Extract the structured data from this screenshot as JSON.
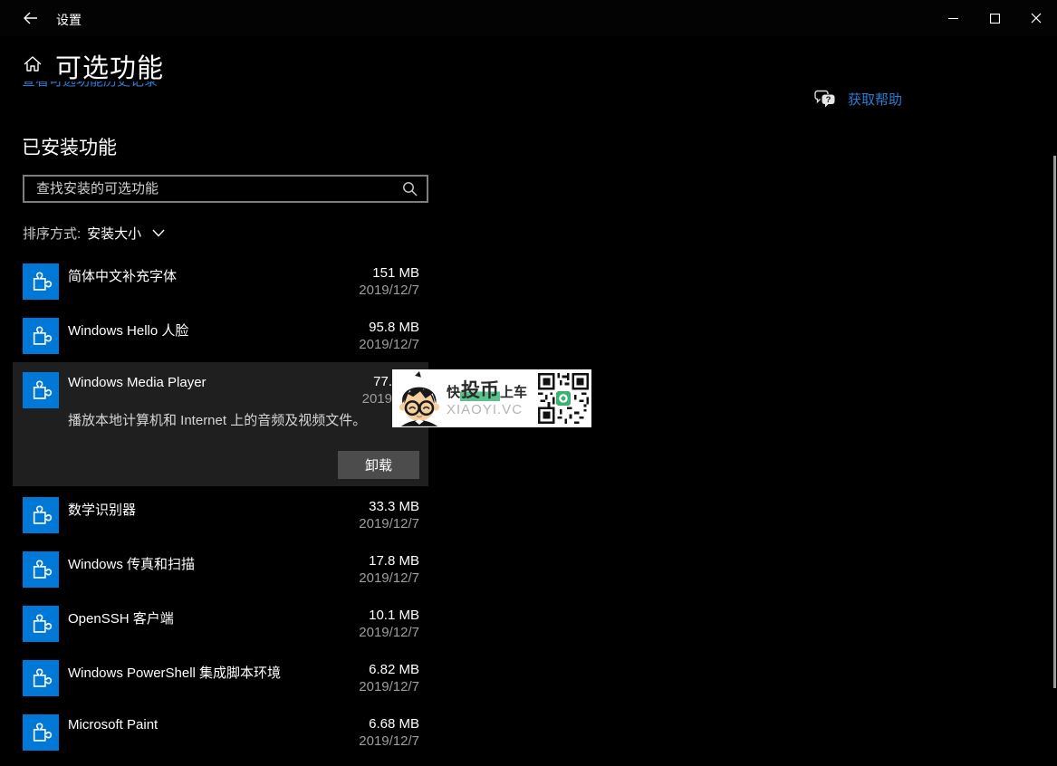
{
  "titlebar": {
    "app_title": "设置"
  },
  "header": {
    "title": "可选功能",
    "history_link": "查看可选功能历史记录",
    "get_help": "获取帮助"
  },
  "main": {
    "section_title": "已安装功能",
    "search_placeholder": "查找安装的可选功能",
    "sort_label": "排序方式:",
    "sort_value": "安装大小",
    "features": [
      {
        "name": "简体中文补充字体",
        "size": "151 MB",
        "date": "2019/12/7"
      },
      {
        "name": "Windows Hello 人脸",
        "size": "95.8 MB",
        "date": "2019/12/7"
      },
      {
        "name": "数学识别器",
        "size": "33.3 MB",
        "date": "2019/12/7"
      },
      {
        "name": "Windows 传真和扫描",
        "size": "17.8 MB",
        "date": "2019/12/7"
      },
      {
        "name": "OpenSSH 客户端",
        "size": "10.1 MB",
        "date": "2019/12/7"
      },
      {
        "name": "Windows PowerShell 集成脚本环境",
        "size": "6.82 MB",
        "date": "2019/12/7"
      },
      {
        "name": "Microsoft Paint",
        "size": "6.68 MB",
        "date": "2019/12/7"
      }
    ],
    "expanded_feature": {
      "name": "Windows Media Player",
      "size_visible": "77.",
      "date_visible": "2019",
      "description": "播放本地计算机和 Internet 上的音频及视频文件。",
      "uninstall_label": "卸载"
    }
  },
  "watermark": {
    "line1_pre": "快",
    "line1_highlight": "投币",
    "line1_post": "上车",
    "line2": "XIAOYI.VC"
  },
  "icons": {
    "feature_tile": "puzzle-piece",
    "help": "chat-bubble-question",
    "search": "magnifier",
    "home": "house"
  },
  "colors": {
    "accent_blue": "#0078d7",
    "link_blue": "#2b7cd3",
    "panel_gray": "#1f1f1f",
    "button_gray": "#4c4c4c",
    "highlight_green": "#57c28c",
    "background": "#000000"
  }
}
